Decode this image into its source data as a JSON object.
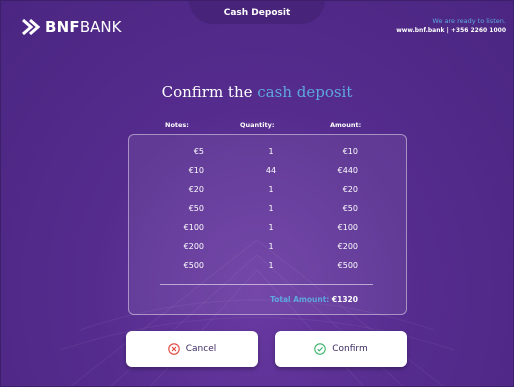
{
  "header": {
    "brand_bold": "BNF",
    "brand_light": "BANK",
    "title": "Cash Deposit",
    "tagline": "We are ready to listen.",
    "contact": "www.bnf.bank | +356 2260 1000"
  },
  "confirm": {
    "heading_prefix": "Confirm the",
    "heading_accent": "cash deposit"
  },
  "table": {
    "columns": {
      "notes": "Notes:",
      "quantity": "Quantity:",
      "amount": "Amount:"
    },
    "rows": [
      {
        "note": "€5",
        "qty": "1",
        "amount": "€10"
      },
      {
        "note": "€10",
        "qty": "44",
        "amount": "€440"
      },
      {
        "note": "€20",
        "qty": "1",
        "amount": "€20"
      },
      {
        "note": "€50",
        "qty": "1",
        "amount": "€50"
      },
      {
        "note": "€100",
        "qty": "1",
        "amount": "€100"
      },
      {
        "note": "€200",
        "qty": "1",
        "amount": "€200"
      },
      {
        "note": "€500",
        "qty": "1",
        "amount": "€500"
      }
    ],
    "total_label": "Total Amount:",
    "total_value": "€1320"
  },
  "buttons": {
    "cancel": "Cancel",
    "confirm": "Confirm"
  },
  "colors": {
    "background": "#552c8e",
    "accent": "#5ea7de",
    "cancel_icon": "#e0443b",
    "confirm_icon": "#3cb36b",
    "button_text": "#3d2b63"
  },
  "icons": {
    "logo": "chevron-logo-icon",
    "cancel": "x-circle-icon",
    "confirm": "check-circle-icon"
  }
}
